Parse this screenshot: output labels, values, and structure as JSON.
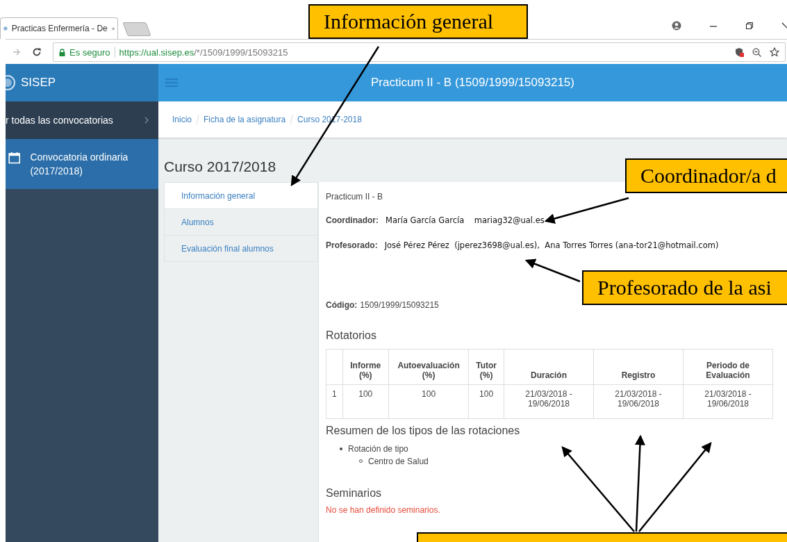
{
  "browser": {
    "tab": {
      "title": "Practicas Enfermería - De"
    },
    "address": {
      "security": "Es seguro",
      "url_host": "https://ual.sisep.es",
      "url_path": "/*/1509/1999/15093215"
    }
  },
  "app": {
    "brand": "SISEP",
    "title": "Practicum II - B (1509/1999/15093215)"
  },
  "sidebar": {
    "items": [
      {
        "label": "r todas las convocatorias",
        "kind": "back",
        "selected": false
      },
      {
        "label": "Convocatoria ordinaria (2017/2018)",
        "kind": "calendar",
        "selected": true
      }
    ]
  },
  "breadcrumb": [
    "Inicio",
    "Ficha de la asignatura",
    "Curso 2017-2018"
  ],
  "heading": "Curso 2017/2018",
  "tabs": [
    {
      "label": "Información general",
      "selected": true
    },
    {
      "label": "Alumnos",
      "selected": false
    },
    {
      "label": "Evaluación final alumnos",
      "selected": false
    }
  ],
  "info": {
    "subject": "Practicum II - B",
    "coordinator": {
      "label": "Coordinador:",
      "value": "María García García    mariag32@ual.es"
    },
    "teachers": {
      "label": "Profesorado:",
      "value": "José Pérez Pérez  (jperez3698@ual.es),  Ana Torres Torres (ana-tor21@hotmail.com)"
    },
    "code": {
      "label": "Código:",
      "value": "1509/1999/15093215"
    }
  },
  "rotations": {
    "title": "Rotatorios",
    "columns": [
      "",
      "Informe\n(%)",
      "Autoevaluación\n(%)",
      "Tutor\n(%)",
      "Duración",
      "Registro",
      "Periodo de\nEvaluación"
    ],
    "rows": [
      [
        "1",
        "100",
        "100",
        "100",
        "21/03/2018 - 19/06/2018",
        "21/03/2018 - 19/06/2018",
        "21/03/2018 - 19/06/2018"
      ]
    ]
  },
  "summary": {
    "title": "Resumen de los tipos de las rotaciones",
    "items": [
      {
        "label": "Rotación de tipo",
        "children": [
          {
            "label": "Centro de Salud"
          }
        ]
      }
    ]
  },
  "seminars": {
    "title": "Seminarios",
    "message": "No se han definido seminarios."
  },
  "callouts": [
    {
      "text": "Información general"
    },
    {
      "text": "Coordinador/a d"
    },
    {
      "text": "Profesorado de la asi"
    }
  ]
}
